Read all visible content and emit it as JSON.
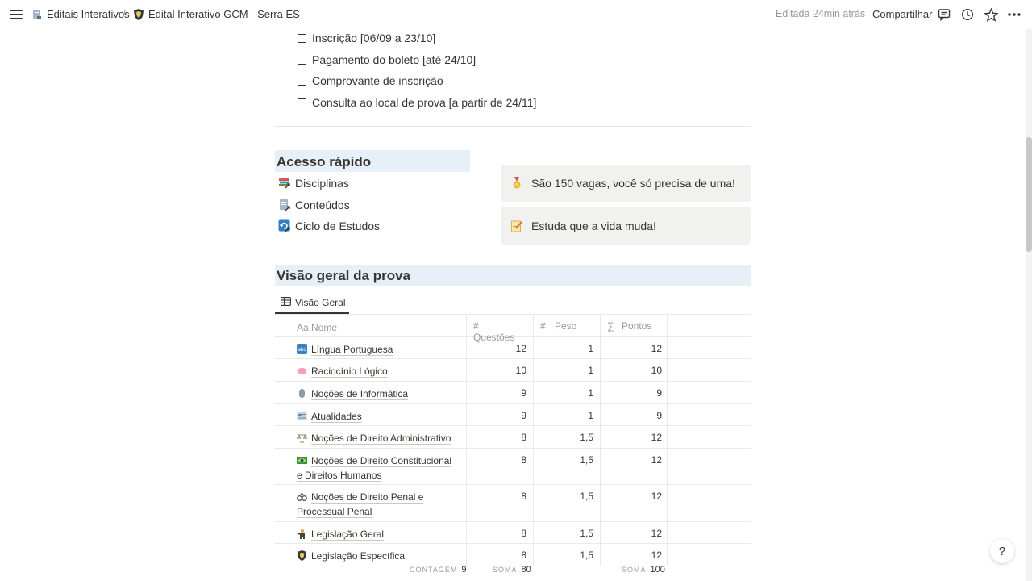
{
  "breadcrumb": {
    "parent": "Editais Interativos",
    "separator": "/",
    "current": "Edital Interativo GCM - Serra ES"
  },
  "topbar": {
    "edited": "Editada 24min atrás",
    "share": "Compartilhar",
    "icons": [
      "comment-icon",
      "history-icon",
      "star-icon",
      "more-icon"
    ]
  },
  "checklist": [
    "Inscrição [06/09 a 23/10]",
    "Pagamento do boleto [até 24/10]",
    "Comprovante de inscrição",
    "Consulta ao local de prova [a partir de 24/11]"
  ],
  "quick_access": {
    "title": "Acesso rápido",
    "links": [
      "Disciplinas",
      "Conteúdos",
      "Ciclo de Estudos"
    ]
  },
  "callouts": [
    {
      "icon": "medal-icon",
      "text": "São 150 vagas, você só precisa de uma!"
    },
    {
      "icon": "memo-icon",
      "text": "Estuda que a vida muda!"
    }
  ],
  "overview": {
    "title": "Visão geral da prova",
    "view_tab": "Visão Geral",
    "headers": {
      "nome": "Nome",
      "questoes": "Questões",
      "peso": "Peso",
      "pontos": "Pontos"
    },
    "rows": [
      {
        "icon": "abc-icon",
        "nome": "Língua Portuguesa",
        "questoes": "12",
        "peso": "1",
        "pontos": "12"
      },
      {
        "icon": "brain-icon",
        "nome": "Raciocínio Lógico",
        "questoes": "10",
        "peso": "1",
        "pontos": "10"
      },
      {
        "icon": "mouse-icon",
        "nome": "Noções de Informática",
        "questoes": "9",
        "peso": "1",
        "pontos": "9"
      },
      {
        "icon": "newspaper-icon",
        "nome": "Atualidades",
        "questoes": "9",
        "peso": "1",
        "pontos": "9"
      },
      {
        "icon": "scales-icon",
        "nome": "Noções de Direito Administrativo",
        "questoes": "8",
        "peso": "1,5",
        "pontos": "12"
      },
      {
        "icon": "brazil-flag-icon",
        "nome": "Noções de Direito Constitucional e Direitos Humanos",
        "questoes": "8",
        "peso": "1,5",
        "pontos": "12"
      },
      {
        "icon": "handcuffs-icon",
        "nome": "Noções de Direito Penal e Processual Penal",
        "questoes": "8",
        "peso": "1,5",
        "pontos": "12"
      },
      {
        "icon": "officer-icon",
        "nome": "Legislação Geral",
        "questoes": "8",
        "peso": "1,5",
        "pontos": "12"
      },
      {
        "icon": "shield-icon",
        "nome": "Legislação Específica",
        "questoes": "8",
        "peso": "1,5",
        "pontos": "12"
      }
    ],
    "footer": {
      "count_label": "CONTAGEM",
      "count": "9",
      "sum_q_label": "SOMA",
      "sum_q": "80",
      "sum_p_label": "SOMA",
      "sum_p": "100"
    }
  },
  "help": "?"
}
